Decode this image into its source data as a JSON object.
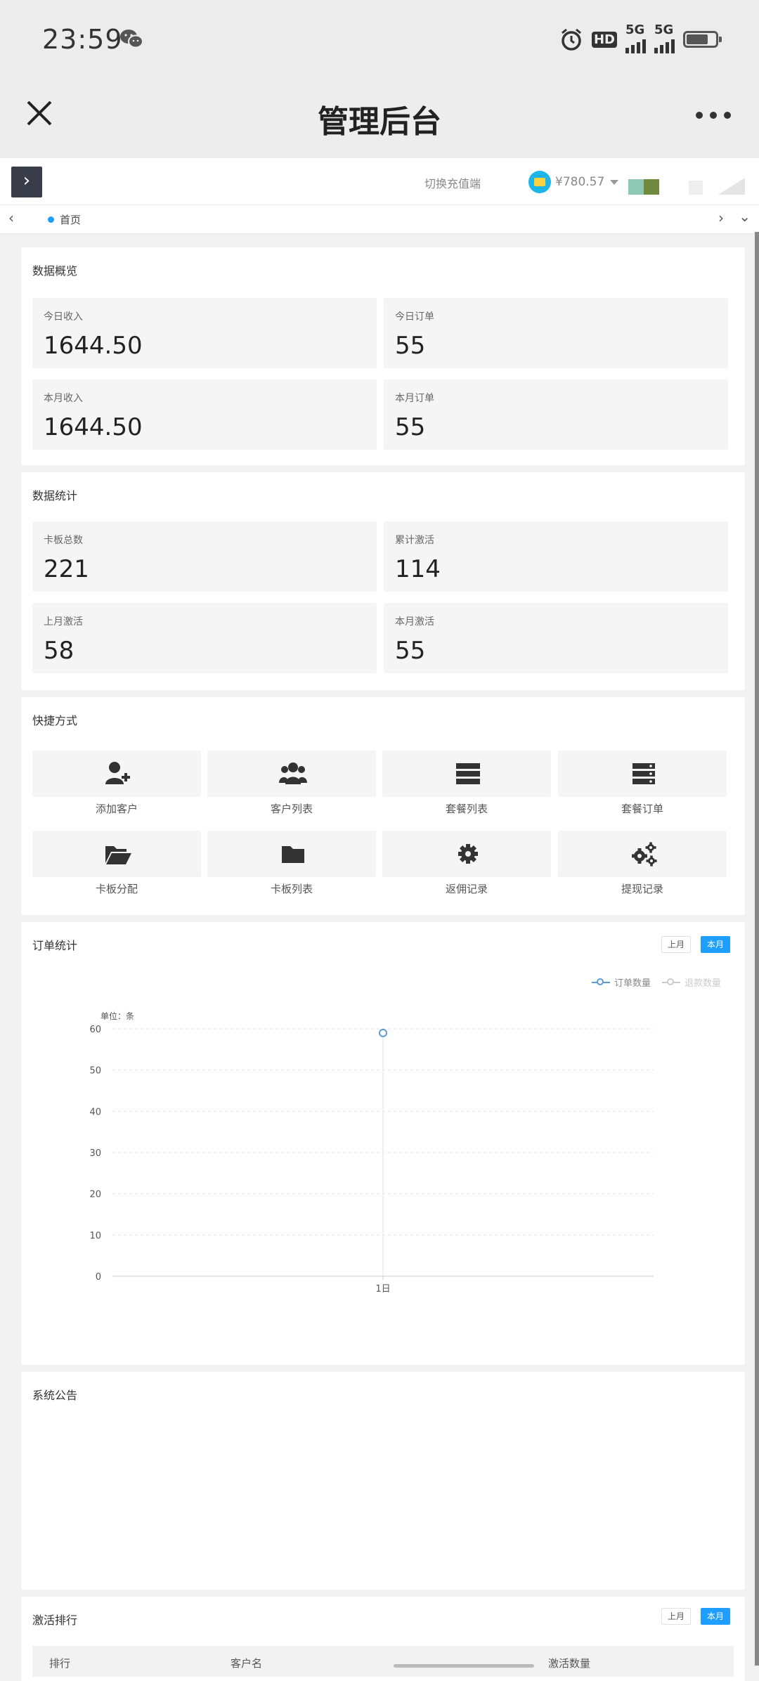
{
  "status_bar": {
    "time": "23:59",
    "hd_label": "HD",
    "net1": "5G",
    "net2": "5G"
  },
  "nav": {
    "title": "管理后台"
  },
  "header": {
    "switch_link": "切换充值端",
    "balance": "¥780.57"
  },
  "tabs": {
    "home": "首页"
  },
  "overview": {
    "title": "数据概览",
    "items": [
      {
        "label": "今日收入",
        "value": "1644.50"
      },
      {
        "label": "今日订单",
        "value": "55"
      },
      {
        "label": "本月收入",
        "value": "1644.50"
      },
      {
        "label": "本月订单",
        "value": "55"
      }
    ]
  },
  "statistics": {
    "title": "数据统计",
    "items": [
      {
        "label": "卡板总数",
        "value": "221"
      },
      {
        "label": "累计激活",
        "value": "114"
      },
      {
        "label": "上月激活",
        "value": "58"
      },
      {
        "label": "本月激活",
        "value": "55"
      }
    ]
  },
  "shortcuts": {
    "title": "快捷方式",
    "items": [
      {
        "label": "添加客户",
        "icon": "user-plus-icon"
      },
      {
        "label": "客户列表",
        "icon": "users-icon"
      },
      {
        "label": "套餐列表",
        "icon": "server-icon"
      },
      {
        "label": "套餐订单",
        "icon": "database-icon"
      },
      {
        "label": "卡板分配",
        "icon": "folder-open-icon"
      },
      {
        "label": "卡板列表",
        "icon": "folder-icon"
      },
      {
        "label": "返佣记录",
        "icon": "gear-icon"
      },
      {
        "label": "提现记录",
        "icon": "gears-icon"
      }
    ]
  },
  "orders_chart": {
    "title": "订单统计",
    "btn_last_month": "上月",
    "btn_this_month": "本月",
    "unit_label": "单位：条"
  },
  "chart_data": {
    "type": "line",
    "categories": [
      "1日"
    ],
    "series": [
      {
        "name": "订单数量",
        "values": [
          59
        ],
        "color": "#5b9bd5"
      },
      {
        "name": "退款数量",
        "values": [],
        "color": "#cccccc"
      }
    ],
    "ylabel": "单位：条",
    "ylim": [
      0,
      60
    ],
    "yticks": [
      0,
      10,
      20,
      30,
      40,
      50,
      60
    ],
    "grid": true,
    "legend": "top-right"
  },
  "announcement": {
    "title": "系统公告"
  },
  "ranking": {
    "title": "激活排行",
    "btn_last_month": "上月",
    "btn_this_month": "本月",
    "columns": [
      "排行",
      "客户名",
      "激活数量"
    ]
  }
}
